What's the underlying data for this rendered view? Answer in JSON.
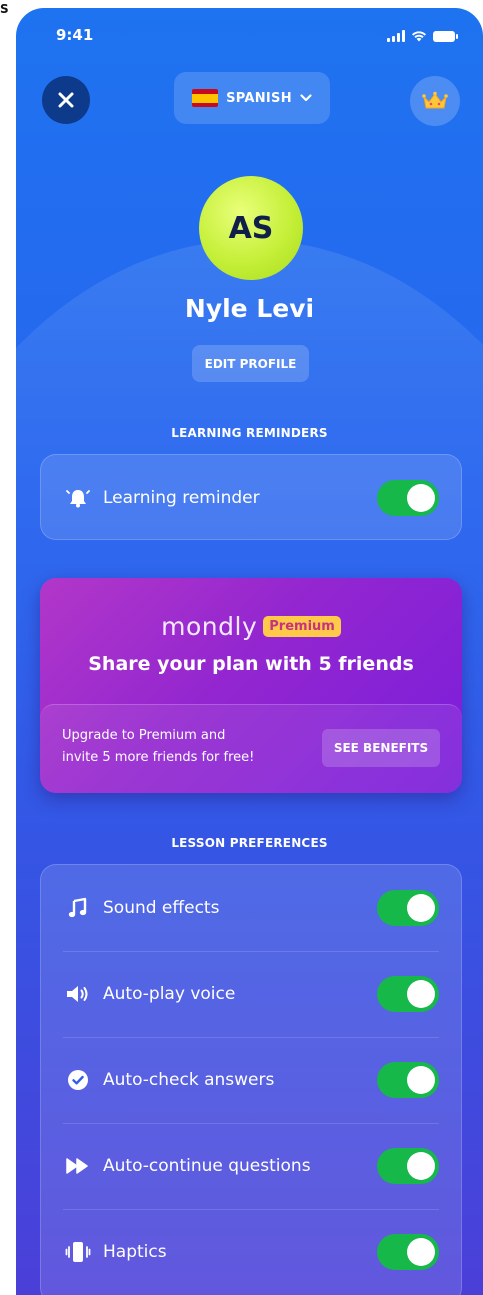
{
  "corner_mark": "S",
  "status_bar": {
    "time": "9:41",
    "icons": [
      "cellular-signal-icon",
      "wifi-icon",
      "battery-icon"
    ]
  },
  "header": {
    "language": {
      "flag": "spain-flag-icon",
      "label": "SPANISH",
      "icon": "chevron-down-icon"
    },
    "close_icon": "close-icon",
    "premium_icon": "crown-icon"
  },
  "profile": {
    "initials": "AS",
    "name": "Nyle Levi",
    "edit_label": "EDIT PROFILE"
  },
  "learning_reminders": {
    "title": "LEARNING REMINDERS",
    "items": [
      {
        "icon": "bell-icon",
        "label": "Learning reminder",
        "enabled": true
      }
    ]
  },
  "promo": {
    "brand": "mondly",
    "badge": "Premium",
    "title": "Share your plan with 5 friends",
    "text_line1": "Upgrade to Premium and",
    "text_line2": "invite 5 more friends for free!",
    "button_label": "SEE BENEFITS"
  },
  "lesson_preferences": {
    "title": "LESSON PREFERENCES",
    "items": [
      {
        "icon": "music-note-icon",
        "label": "Sound effects",
        "enabled": true
      },
      {
        "icon": "speaker-icon",
        "label": "Auto-play voice",
        "enabled": true
      },
      {
        "icon": "check-circle-icon",
        "label": "Auto-check answers",
        "enabled": true
      },
      {
        "icon": "fast-forward-icon",
        "label": "Auto-continue questions",
        "enabled": true
      },
      {
        "icon": "phone-vibrate-icon",
        "label": "Haptics",
        "enabled": true
      }
    ]
  },
  "colors": {
    "toggle_on": "#16b84a",
    "avatar": "#c5ef38",
    "promo_start": "#b237c9",
    "promo_end": "#7a1edb",
    "badge": "#ffc94a"
  }
}
